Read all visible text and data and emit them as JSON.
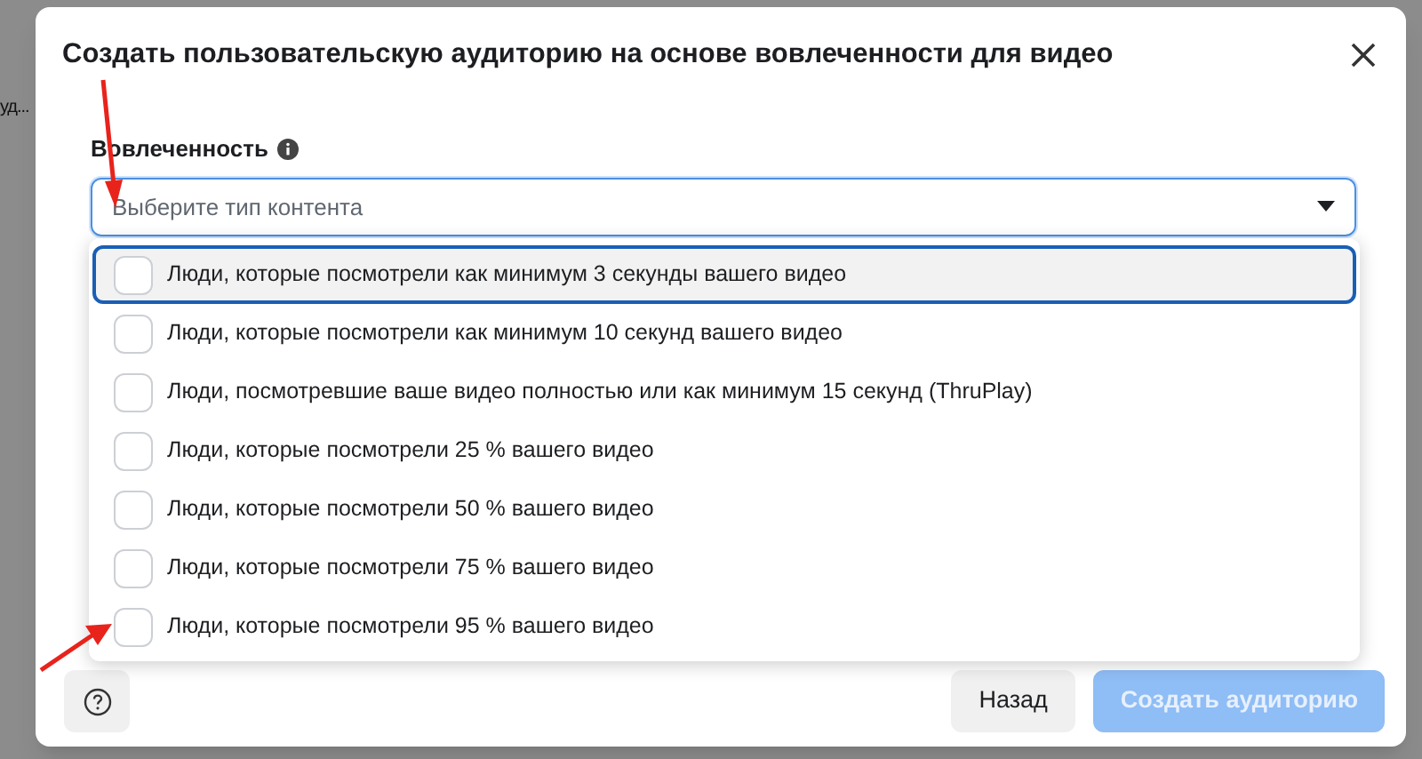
{
  "backdrop": {
    "texts": [
      "уд..."
    ]
  },
  "dialog": {
    "title": "Создать пользовательскую аудиторию на основе вовлеченности для видео",
    "field": {
      "label": "Вовлеченность",
      "placeholder": "Выберите тип контента",
      "expanded": true
    },
    "options": [
      {
        "label": "Люди, которые посмотрели как минимум 3 секунды вашего видео",
        "checked": false,
        "highlighted": true
      },
      {
        "label": "Люди, которые посмотрели как минимум 10 секунд вашего видео",
        "checked": false,
        "highlighted": false
      },
      {
        "label": "Люди, посмотревшие ваше видео полностью или как минимум 15 секунд (ThruPlay)",
        "checked": false,
        "highlighted": false
      },
      {
        "label": "Люди, которые посмотрели 25 % вашего видео",
        "checked": false,
        "highlighted": false
      },
      {
        "label": "Люди, которые посмотрели 50 % вашего видео",
        "checked": false,
        "highlighted": false
      },
      {
        "label": "Люди, которые посмотрели 75 % вашего видео",
        "checked": false,
        "highlighted": false
      },
      {
        "label": "Люди, которые посмотрели 95 % вашего видео",
        "checked": false,
        "highlighted": false
      }
    ],
    "buttons": [
      {
        "label": "Назад",
        "kind": "secondary",
        "disabled": false
      },
      {
        "label": "Создать аудиторию",
        "kind": "primary",
        "disabled": true
      }
    ]
  }
}
